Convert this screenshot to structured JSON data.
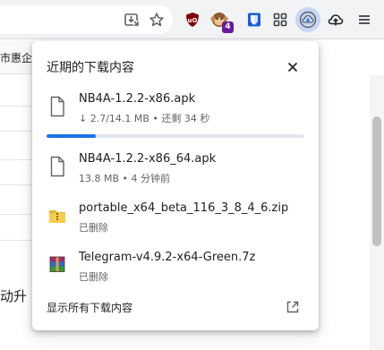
{
  "page": {
    "bookmark_text": "市惠企",
    "body_text": "动升"
  },
  "toolbar": {
    "icons": [
      "install-icon",
      "star-icon",
      "ublock-icon",
      "monkey-extension-icon",
      "bitwarden-icon",
      "extensions-grid-icon",
      "download-cloud-icon",
      "upload-cloud-icon",
      "menu-icon"
    ],
    "monkey_badge": "4"
  },
  "downloads": {
    "title": "近期的下载内容",
    "items": [
      {
        "name": "NB4A-1.2.2-x86.apk",
        "status": "↓ 2.7/14.1 MB • 还剩 34 秒",
        "icon": "file-icon",
        "progress": 0.19
      },
      {
        "name": "NB4A-1.2.2-x86_64.apk",
        "status": "13.8 MB • 4 分钟前",
        "icon": "file-icon"
      },
      {
        "name": "portable_x64_beta_116_3_8_4_6.zip",
        "status": "已删除",
        "icon": "zip-archive-icon"
      },
      {
        "name": "Telegram-v4.9.2-x64-Green.7z",
        "status": "已删除",
        "icon": "rar-archive-icon"
      }
    ],
    "show_all": "显示所有下载内容"
  },
  "colors": {
    "accent": "#1a73e8",
    "toolbar_bg": "#f1f3f4",
    "active_extension_bg": "#c7d7f3"
  }
}
